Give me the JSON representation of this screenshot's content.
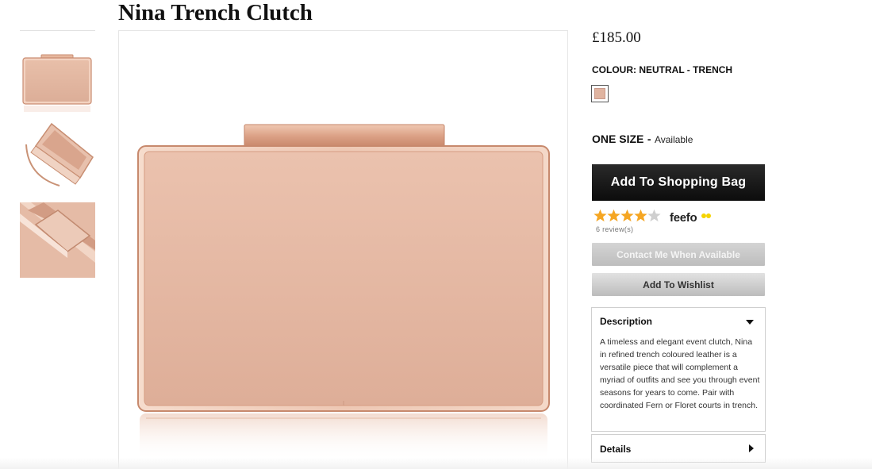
{
  "product": {
    "title": "Nina Trench Clutch",
    "price": "£185.00",
    "colour_label": "COLOUR: NEUTRAL - TRENCH",
    "swatch_color": "#e0b4a0",
    "size_label": "ONE SIZE",
    "size_dash": "-",
    "size_status": "Available"
  },
  "gallery": {
    "thumbnails": [
      {
        "icon": "clutch-front-thumbnail"
      },
      {
        "icon": "clutch-open-thumbnail"
      },
      {
        "icon": "clutch-clasp-detail-thumbnail"
      }
    ],
    "main_image": "clutch-front-image"
  },
  "actions": {
    "add_to_bag": "Add To Shopping Bag",
    "contact": "Contact Me When Available",
    "wishlist": "Add To Wishlist"
  },
  "rating": {
    "stars": 4,
    "max_stars": 5,
    "star_color": "#f5a623",
    "provider": "feefo",
    "reviews": "6 review(s)"
  },
  "description": {
    "heading": "Description",
    "text": "A timeless and elegant event clutch, Nina in refined trench coloured leather is a versatile piece that will complement a myriad of outfits and see you through event seasons for years to come. Pair with coordinated Fern or Floret courts in trench."
  },
  "details": {
    "heading": "Details"
  }
}
